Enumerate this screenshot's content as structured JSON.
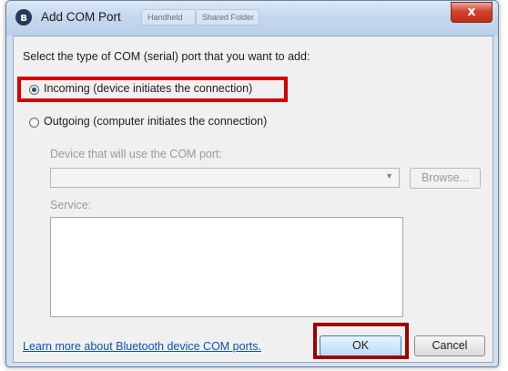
{
  "window": {
    "title": "Add COM Port",
    "close_symbol": "x",
    "title_icon": "bluetooth-icon",
    "title_icon_glyph": "ʙ",
    "background_tabs": [
      "Handheld",
      "Shared Folder"
    ]
  },
  "dialog": {
    "prompt": "Select the type of COM (serial) port that you want to add:",
    "options": [
      {
        "label": "Incoming (device initiates the connection)",
        "checked": true
      },
      {
        "label": "Outgoing (computer initiates the connection)",
        "checked": false
      }
    ],
    "device_label": "Device that will use the COM port:",
    "device_value": "",
    "browse_label": "Browse...",
    "service_label": "Service:",
    "service_value": "",
    "help_link": "Learn more about Bluetooth device COM ports.",
    "ok_label": "OK",
    "cancel_label": "Cancel"
  },
  "colors": {
    "highlight": "#d40000",
    "link": "#0b52b8"
  }
}
